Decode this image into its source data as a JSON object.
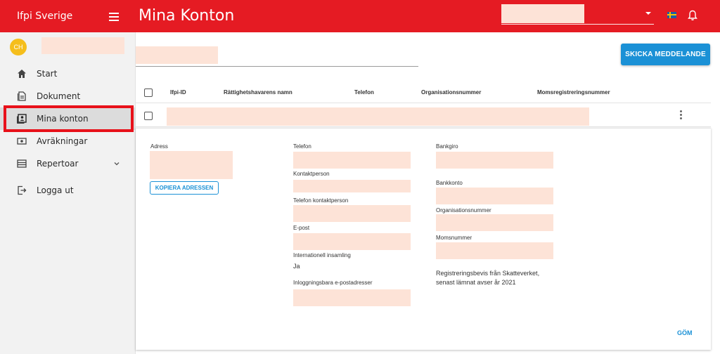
{
  "app": {
    "brand": "Ifpi Sverige",
    "page_title": "Mina Konton"
  },
  "user": {
    "initials": "CH"
  },
  "sidebar": {
    "items": [
      {
        "label": "Start"
      },
      {
        "label": "Dokument"
      },
      {
        "label": "Mina konton"
      },
      {
        "label": "Avräkningar"
      },
      {
        "label": "Repertoar"
      },
      {
        "label": "Logga ut"
      }
    ]
  },
  "toolbar": {
    "send_label": "SKICKA MEDDELANDE"
  },
  "table": {
    "columns": [
      "Ifpi-ID",
      "Rättighetshavarens namn",
      "Telefon",
      "Organisationsnummer",
      "Momsregistreringsnummer"
    ]
  },
  "detail": {
    "address_label": "Adress",
    "copy_label": "KOPIERA ADRESSEN",
    "phone_label": "Telefon",
    "contact_label": "Kontaktperson",
    "contact_phone_label": "Telefon kontaktperson",
    "email_label": "E-post",
    "intl_label": "Internationell insamling",
    "intl_value": "Ja",
    "login_emails_label": "Inloggningsbara e-postadresser",
    "bankgiro_label": "Bankgiro",
    "bankkonto_label": "Bankkonto",
    "org_label": "Organisationsnummer",
    "moms_label": "Momsnummer",
    "reg_text": "Registreringsbevis från Skatteverket, senast lämnat avser år 2021",
    "hide_label": "GÖM"
  },
  "colors": {
    "topbar": "#e51b23",
    "accent": "#1b91d6",
    "avatar": "#f5be1c",
    "redaction": "#fde3d7"
  }
}
